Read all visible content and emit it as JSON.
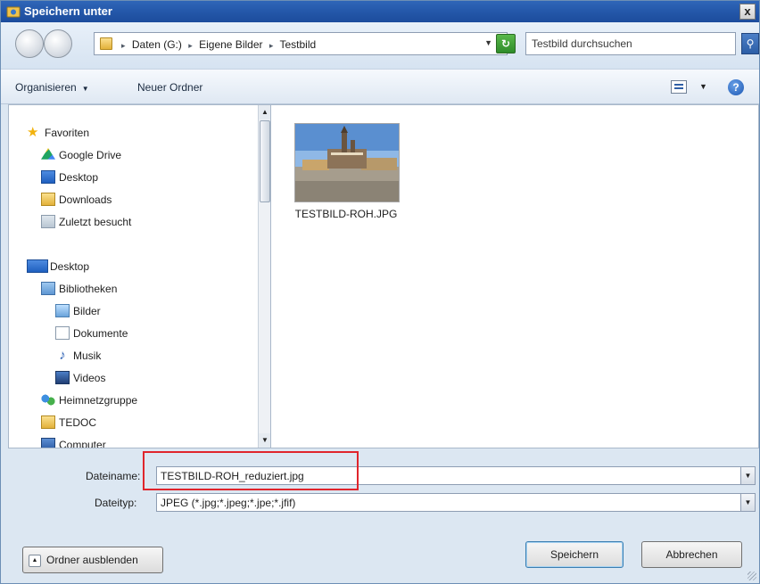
{
  "window": {
    "title": "Speichern unter",
    "close_label": "x"
  },
  "address": {
    "crumbs": [
      "Daten (G:)",
      "Eigene Bilder",
      "Testbild"
    ],
    "search_placeholder": "Testbild durchsuchen"
  },
  "toolbar": {
    "organize_label": "Organisieren",
    "new_folder_label": "Neuer Ordner"
  },
  "sidebar": {
    "items": [
      {
        "label": "Favoriten",
        "icon": "star-icon"
      },
      {
        "label": "Google Drive",
        "icon": "google-drive-icon"
      },
      {
        "label": "Desktop",
        "icon": "desktop-icon"
      },
      {
        "label": "Downloads",
        "icon": "downloads-folder-icon"
      },
      {
        "label": "Zuletzt besucht",
        "icon": "recent-places-icon"
      },
      {
        "label": "Desktop",
        "icon": "desktop-icon"
      },
      {
        "label": "Bibliotheken",
        "icon": "libraries-icon"
      },
      {
        "label": "Bilder",
        "icon": "pictures-icon"
      },
      {
        "label": "Dokumente",
        "icon": "documents-icon"
      },
      {
        "label": "Musik",
        "icon": "music-icon"
      },
      {
        "label": "Videos",
        "icon": "videos-icon"
      },
      {
        "label": "Heimnetzgruppe",
        "icon": "homegroup-icon"
      },
      {
        "label": "TEDOC",
        "icon": "folder-icon"
      },
      {
        "label": "Computer",
        "icon": "computer-icon"
      }
    ]
  },
  "files": [
    {
      "name": "TESTBILD-ROH.JPG",
      "icon": "image-thumbnail"
    }
  ],
  "form": {
    "filename_label": "Dateiname:",
    "filename_value": "TESTBILD-ROH_reduziert.jpg",
    "filetype_label": "Dateityp:",
    "filetype_value": "JPEG (*.jpg;*.jpeg;*.jpe;*.jfif)"
  },
  "buttons": {
    "hide_folders": "Ordner ausblenden",
    "save": "Speichern",
    "cancel": "Abbrechen"
  },
  "colors": {
    "title_bar": "#2356a8",
    "highlight_box": "#e0252c",
    "window_bg": "#dce7f2"
  }
}
